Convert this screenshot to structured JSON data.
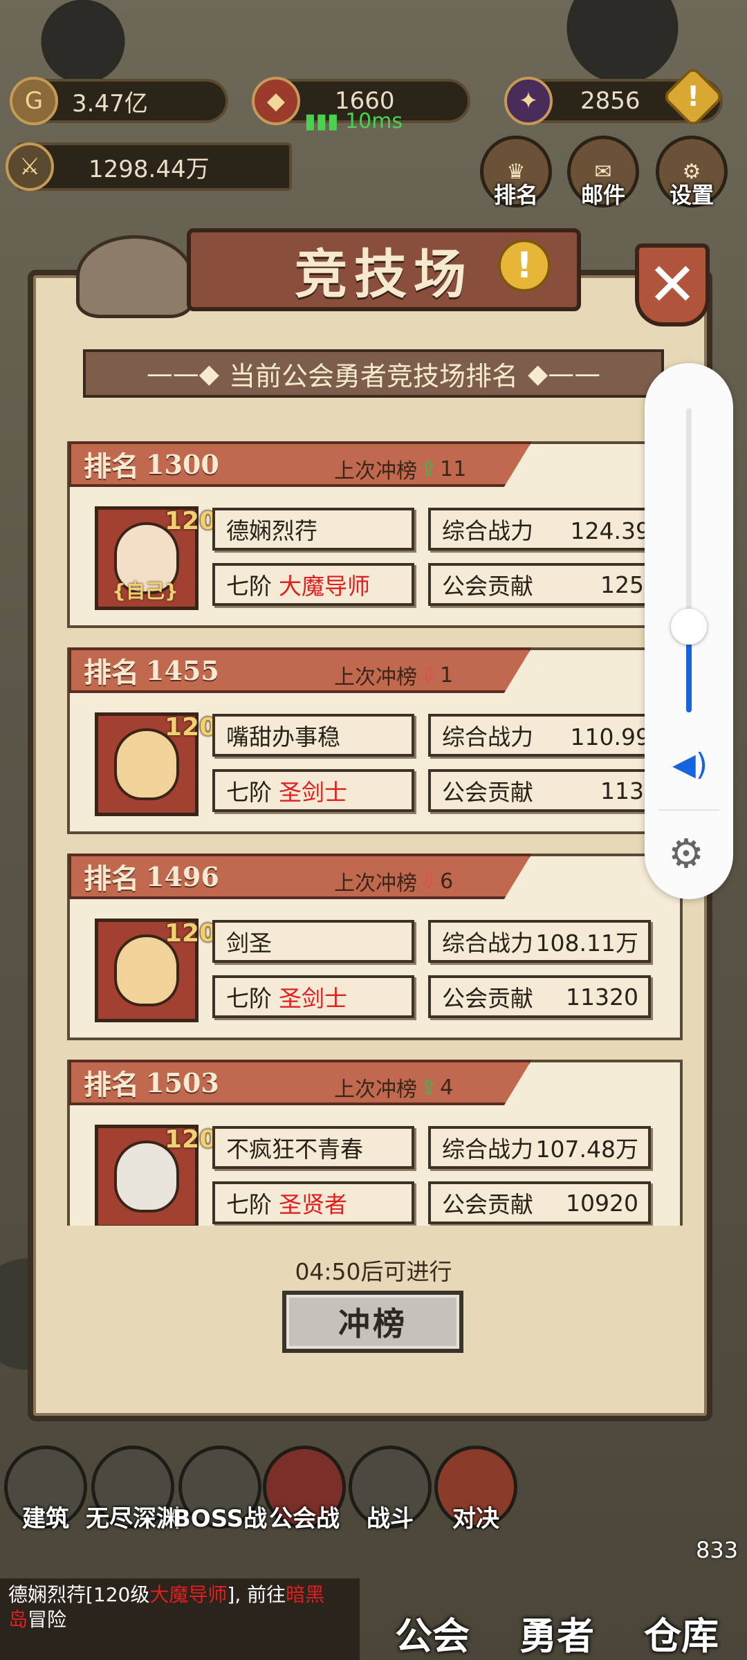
{
  "resources": {
    "gold": "3.47亿",
    "crest": "1660",
    "ping": "10ms",
    "essence": "2856",
    "power": "1298.44万"
  },
  "top_buttons": [
    "排名",
    "邮件",
    "设置"
  ],
  "modal": {
    "title": "竞技场",
    "subtitle": "当前公会勇者竞技场排名",
    "timer": "04:50后可进行",
    "action": "冲榜"
  },
  "labels": {
    "rank": "排名",
    "prev": "上次冲榜",
    "power": "综合战力",
    "contrib": "公会贡献",
    "tier": "七阶",
    "self": "自己"
  },
  "rankings": [
    {
      "rank": "1300",
      "trend": "up",
      "change": "11",
      "level": "120",
      "name": "德娴烈荇",
      "class": "大魔导师",
      "power": "124.39万",
      "contrib": "12522",
      "self": true
    },
    {
      "rank": "1455",
      "trend": "down",
      "change": "1",
      "level": "120",
      "name": "嘴甜办事稳",
      "class": "圣剑士",
      "power": "110.99万",
      "contrib": "11357",
      "self": false
    },
    {
      "rank": "1496",
      "trend": "down",
      "change": "6",
      "level": "120",
      "name": "剑圣",
      "class": "圣剑士",
      "power": "108.11万",
      "contrib": "11320",
      "self": false
    },
    {
      "rank": "1503",
      "trend": "up",
      "change": "4",
      "level": "120",
      "name": "不疯狂不青春",
      "class": "圣贤者",
      "power": "107.48万",
      "contrib": "10920",
      "self": false
    }
  ],
  "bottom_nav": [
    "建筑",
    "无尽深渊",
    "BOSS战",
    "公会战",
    "战斗",
    "对决"
  ],
  "main_tabs": [
    "公会",
    "勇者",
    "仓库"
  ],
  "badge": "833",
  "chat": {
    "line1": "德娴烈荇[120级",
    "line1_class": "大魔导师",
    "line1_end": "], 前往",
    "line1_place": "暗黑",
    "line2_place": "岛",
    "line2_end": "冒险"
  },
  "colors": {
    "accent_red": "#e01f1f",
    "up_green": "#4bb14e",
    "down_red": "#d9534f",
    "volume_blue": "#1565e0"
  }
}
